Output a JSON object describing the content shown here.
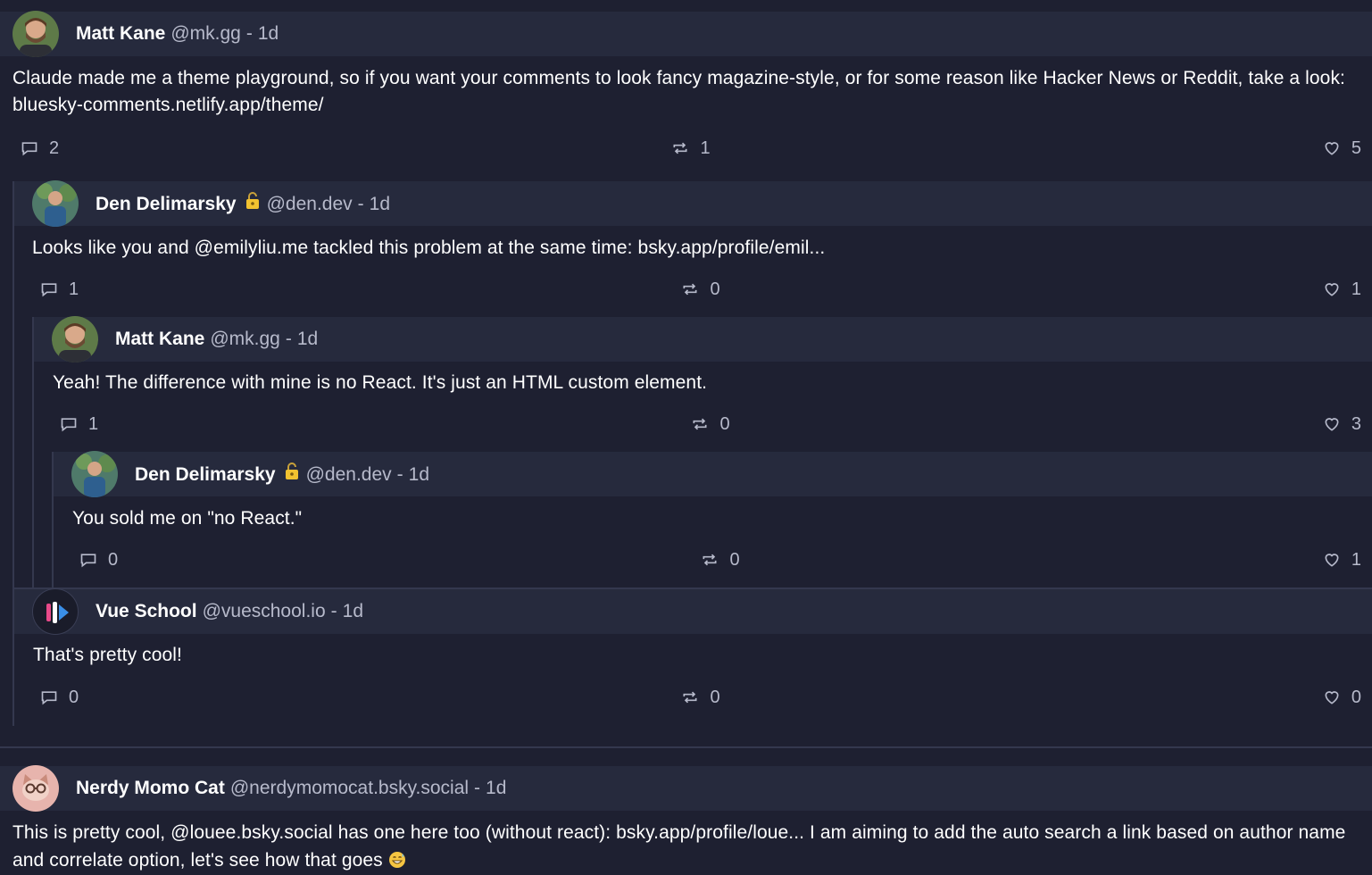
{
  "comments": [
    {
      "name": "Matt Kane",
      "handle": "@mk.gg",
      "time": "1d",
      "text": "Claude made me a theme playground, so if you want your comments to look fancy magazine-style, or for some reason like Hacker News or Reddit, take a look: bluesky-comments.netlify.app/theme/",
      "replies": "2",
      "reposts": "1",
      "likes": "5",
      "avatar_icon": "bearded-man-avatar"
    },
    {
      "name": "Den Delimarsky",
      "handle": "@den.dev",
      "time": "1d",
      "text": "Looks like you and @emilyliu.me tackled this problem at the same time: bsky.app/profile/emil...",
      "replies": "1",
      "reposts": "0",
      "likes": "1",
      "avatar_icon": "man-outdoors-avatar",
      "badge_icon": "lock-key-icon"
    },
    {
      "name": "Matt Kane",
      "handle": "@mk.gg",
      "time": "1d",
      "text": "Yeah! The difference with mine is no React. It's just an HTML custom element.",
      "replies": "1",
      "reposts": "0",
      "likes": "3",
      "avatar_icon": "bearded-man-avatar"
    },
    {
      "name": "Den Delimarsky",
      "handle": "@den.dev",
      "time": "1d",
      "text": "You sold me on \"no React.\"",
      "replies": "0",
      "reposts": "0",
      "likes": "1",
      "avatar_icon": "man-outdoors-avatar",
      "badge_icon": "lock-key-icon"
    },
    {
      "name": "Vue School",
      "handle": "@vueschool.io",
      "time": "1d",
      "text": "That's pretty cool!",
      "replies": "0",
      "reposts": "0",
      "likes": "0",
      "avatar_icon": "vue-school-logo"
    },
    {
      "name": "Nerdy Momo Cat",
      "handle": "@nerdymomocat.bsky.social",
      "time": "1d",
      "text": "This is pretty cool, @louee.bsky.social has one here too (without react): bsky.app/profile/loue... I am aiming to add the auto search a link based on author name and correlate option, let's see how that goes",
      "emoji": "grinning-sweat-emoji",
      "avatar_icon": "cat-with-glasses-avatar"
    }
  ],
  "separator": "-",
  "colors": {
    "background": "#1e2031",
    "header_bg": "#262a3d",
    "muted_text": "#b7bacb",
    "thread_line": "#34384e"
  }
}
